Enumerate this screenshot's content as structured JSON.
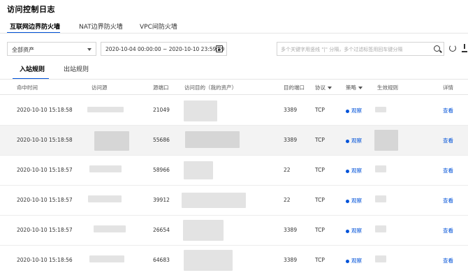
{
  "page": {
    "title": "访问控制日志"
  },
  "firewall_tabs": [
    {
      "label": "互联网边界防火墙",
      "active": true
    },
    {
      "label": "NAT边界防火墙",
      "active": false
    },
    {
      "label": "VPC间防火墙",
      "active": false
    }
  ],
  "filters": {
    "asset_select": "全部资产",
    "date_range": "2020-10-04 00:00:00 ~ 2020-10-10 23:59:59",
    "search_placeholder": "多个关键字用竖线 \"|\" 分隔，多个过滤标签用回车键分隔"
  },
  "direction_tabs": [
    {
      "label": "入站规则",
      "active": true
    },
    {
      "label": "出站规则",
      "active": false
    }
  ],
  "table": {
    "headers": {
      "time": "命中时间",
      "source": "访问源",
      "src_port": "源端口",
      "destination": "访问目的（我的资产）",
      "dst_port": "目的端口",
      "protocol": "协议",
      "policy": "策略",
      "rule": "生效规则",
      "detail": "详情"
    },
    "rows": [
      {
        "time": "2020-10-10 15:18:58",
        "src_port": "21049",
        "dst_port": "3389",
        "protocol": "TCP",
        "policy": "观察",
        "detail": "查看"
      },
      {
        "time": "2020-10-10 15:18:58",
        "src_port": "55686",
        "dst_port": "3389",
        "protocol": "TCP",
        "policy": "观察",
        "detail": "查看"
      },
      {
        "time": "2020-10-10 15:18:57",
        "src_port": "58966",
        "dst_port": "22",
        "protocol": "TCP",
        "policy": "观察",
        "detail": "查看"
      },
      {
        "time": "2020-10-10 15:18:57",
        "src_port": "39912",
        "dst_port": "22",
        "protocol": "TCP",
        "policy": "观察",
        "detail": "查看"
      },
      {
        "time": "2020-10-10 15:18:57",
        "src_port": "26654",
        "dst_port": "3389",
        "protocol": "TCP",
        "policy": "观察",
        "detail": "查看"
      },
      {
        "time": "2020-10-10 15:18:56",
        "src_port": "64683",
        "dst_port": "3389",
        "protocol": "TCP",
        "policy": "观察",
        "detail": "查看"
      }
    ]
  },
  "colors": {
    "accent": "#0052d9"
  }
}
